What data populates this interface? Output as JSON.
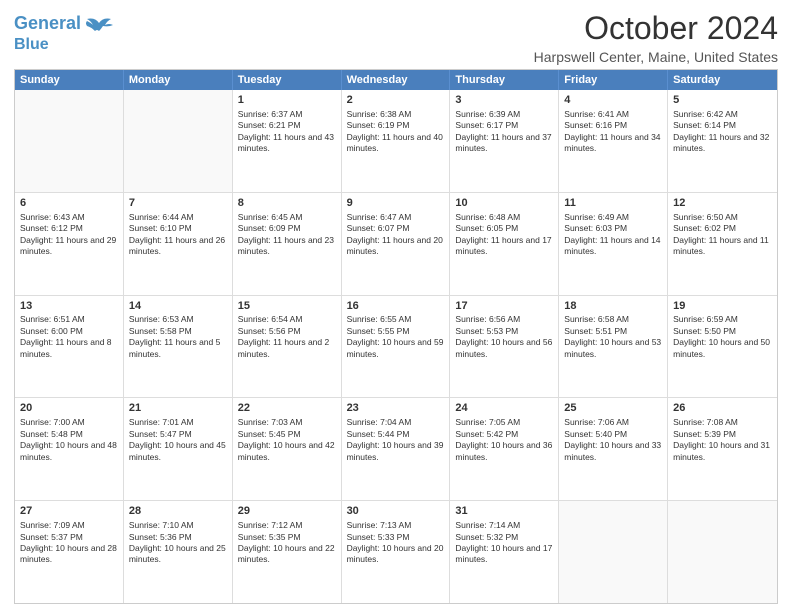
{
  "logo": {
    "line1": "General",
    "line2": "Blue"
  },
  "title": "October 2024",
  "subtitle": "Harpswell Center, Maine, United States",
  "header_days": [
    "Sunday",
    "Monday",
    "Tuesday",
    "Wednesday",
    "Thursday",
    "Friday",
    "Saturday"
  ],
  "weeks": [
    [
      {
        "day": "",
        "sunrise": "",
        "sunset": "",
        "daylight": "",
        "empty": true
      },
      {
        "day": "",
        "sunrise": "",
        "sunset": "",
        "daylight": "",
        "empty": true
      },
      {
        "day": "1",
        "sunrise": "Sunrise: 6:37 AM",
        "sunset": "Sunset: 6:21 PM",
        "daylight": "Daylight: 11 hours and 43 minutes.",
        "empty": false
      },
      {
        "day": "2",
        "sunrise": "Sunrise: 6:38 AM",
        "sunset": "Sunset: 6:19 PM",
        "daylight": "Daylight: 11 hours and 40 minutes.",
        "empty": false
      },
      {
        "day": "3",
        "sunrise": "Sunrise: 6:39 AM",
        "sunset": "Sunset: 6:17 PM",
        "daylight": "Daylight: 11 hours and 37 minutes.",
        "empty": false
      },
      {
        "day": "4",
        "sunrise": "Sunrise: 6:41 AM",
        "sunset": "Sunset: 6:16 PM",
        "daylight": "Daylight: 11 hours and 34 minutes.",
        "empty": false
      },
      {
        "day": "5",
        "sunrise": "Sunrise: 6:42 AM",
        "sunset": "Sunset: 6:14 PM",
        "daylight": "Daylight: 11 hours and 32 minutes.",
        "empty": false
      }
    ],
    [
      {
        "day": "6",
        "sunrise": "Sunrise: 6:43 AM",
        "sunset": "Sunset: 6:12 PM",
        "daylight": "Daylight: 11 hours and 29 minutes.",
        "empty": false
      },
      {
        "day": "7",
        "sunrise": "Sunrise: 6:44 AM",
        "sunset": "Sunset: 6:10 PM",
        "daylight": "Daylight: 11 hours and 26 minutes.",
        "empty": false
      },
      {
        "day": "8",
        "sunrise": "Sunrise: 6:45 AM",
        "sunset": "Sunset: 6:09 PM",
        "daylight": "Daylight: 11 hours and 23 minutes.",
        "empty": false
      },
      {
        "day": "9",
        "sunrise": "Sunrise: 6:47 AM",
        "sunset": "Sunset: 6:07 PM",
        "daylight": "Daylight: 11 hours and 20 minutes.",
        "empty": false
      },
      {
        "day": "10",
        "sunrise": "Sunrise: 6:48 AM",
        "sunset": "Sunset: 6:05 PM",
        "daylight": "Daylight: 11 hours and 17 minutes.",
        "empty": false
      },
      {
        "day": "11",
        "sunrise": "Sunrise: 6:49 AM",
        "sunset": "Sunset: 6:03 PM",
        "daylight": "Daylight: 11 hours and 14 minutes.",
        "empty": false
      },
      {
        "day": "12",
        "sunrise": "Sunrise: 6:50 AM",
        "sunset": "Sunset: 6:02 PM",
        "daylight": "Daylight: 11 hours and 11 minutes.",
        "empty": false
      }
    ],
    [
      {
        "day": "13",
        "sunrise": "Sunrise: 6:51 AM",
        "sunset": "Sunset: 6:00 PM",
        "daylight": "Daylight: 11 hours and 8 minutes.",
        "empty": false
      },
      {
        "day": "14",
        "sunrise": "Sunrise: 6:53 AM",
        "sunset": "Sunset: 5:58 PM",
        "daylight": "Daylight: 11 hours and 5 minutes.",
        "empty": false
      },
      {
        "day": "15",
        "sunrise": "Sunrise: 6:54 AM",
        "sunset": "Sunset: 5:56 PM",
        "daylight": "Daylight: 11 hours and 2 minutes.",
        "empty": false
      },
      {
        "day": "16",
        "sunrise": "Sunrise: 6:55 AM",
        "sunset": "Sunset: 5:55 PM",
        "daylight": "Daylight: 10 hours and 59 minutes.",
        "empty": false
      },
      {
        "day": "17",
        "sunrise": "Sunrise: 6:56 AM",
        "sunset": "Sunset: 5:53 PM",
        "daylight": "Daylight: 10 hours and 56 minutes.",
        "empty": false
      },
      {
        "day": "18",
        "sunrise": "Sunrise: 6:58 AM",
        "sunset": "Sunset: 5:51 PM",
        "daylight": "Daylight: 10 hours and 53 minutes.",
        "empty": false
      },
      {
        "day": "19",
        "sunrise": "Sunrise: 6:59 AM",
        "sunset": "Sunset: 5:50 PM",
        "daylight": "Daylight: 10 hours and 50 minutes.",
        "empty": false
      }
    ],
    [
      {
        "day": "20",
        "sunrise": "Sunrise: 7:00 AM",
        "sunset": "Sunset: 5:48 PM",
        "daylight": "Daylight: 10 hours and 48 minutes.",
        "empty": false
      },
      {
        "day": "21",
        "sunrise": "Sunrise: 7:01 AM",
        "sunset": "Sunset: 5:47 PM",
        "daylight": "Daylight: 10 hours and 45 minutes.",
        "empty": false
      },
      {
        "day": "22",
        "sunrise": "Sunrise: 7:03 AM",
        "sunset": "Sunset: 5:45 PM",
        "daylight": "Daylight: 10 hours and 42 minutes.",
        "empty": false
      },
      {
        "day": "23",
        "sunrise": "Sunrise: 7:04 AM",
        "sunset": "Sunset: 5:44 PM",
        "daylight": "Daylight: 10 hours and 39 minutes.",
        "empty": false
      },
      {
        "day": "24",
        "sunrise": "Sunrise: 7:05 AM",
        "sunset": "Sunset: 5:42 PM",
        "daylight": "Daylight: 10 hours and 36 minutes.",
        "empty": false
      },
      {
        "day": "25",
        "sunrise": "Sunrise: 7:06 AM",
        "sunset": "Sunset: 5:40 PM",
        "daylight": "Daylight: 10 hours and 33 minutes.",
        "empty": false
      },
      {
        "day": "26",
        "sunrise": "Sunrise: 7:08 AM",
        "sunset": "Sunset: 5:39 PM",
        "daylight": "Daylight: 10 hours and 31 minutes.",
        "empty": false
      }
    ],
    [
      {
        "day": "27",
        "sunrise": "Sunrise: 7:09 AM",
        "sunset": "Sunset: 5:37 PM",
        "daylight": "Daylight: 10 hours and 28 minutes.",
        "empty": false
      },
      {
        "day": "28",
        "sunrise": "Sunrise: 7:10 AM",
        "sunset": "Sunset: 5:36 PM",
        "daylight": "Daylight: 10 hours and 25 minutes.",
        "empty": false
      },
      {
        "day": "29",
        "sunrise": "Sunrise: 7:12 AM",
        "sunset": "Sunset: 5:35 PM",
        "daylight": "Daylight: 10 hours and 22 minutes.",
        "empty": false
      },
      {
        "day": "30",
        "sunrise": "Sunrise: 7:13 AM",
        "sunset": "Sunset: 5:33 PM",
        "daylight": "Daylight: 10 hours and 20 minutes.",
        "empty": false
      },
      {
        "day": "31",
        "sunrise": "Sunrise: 7:14 AM",
        "sunset": "Sunset: 5:32 PM",
        "daylight": "Daylight: 10 hours and 17 minutes.",
        "empty": false
      },
      {
        "day": "",
        "sunrise": "",
        "sunset": "",
        "daylight": "",
        "empty": true
      },
      {
        "day": "",
        "sunrise": "",
        "sunset": "",
        "daylight": "",
        "empty": true
      }
    ]
  ]
}
